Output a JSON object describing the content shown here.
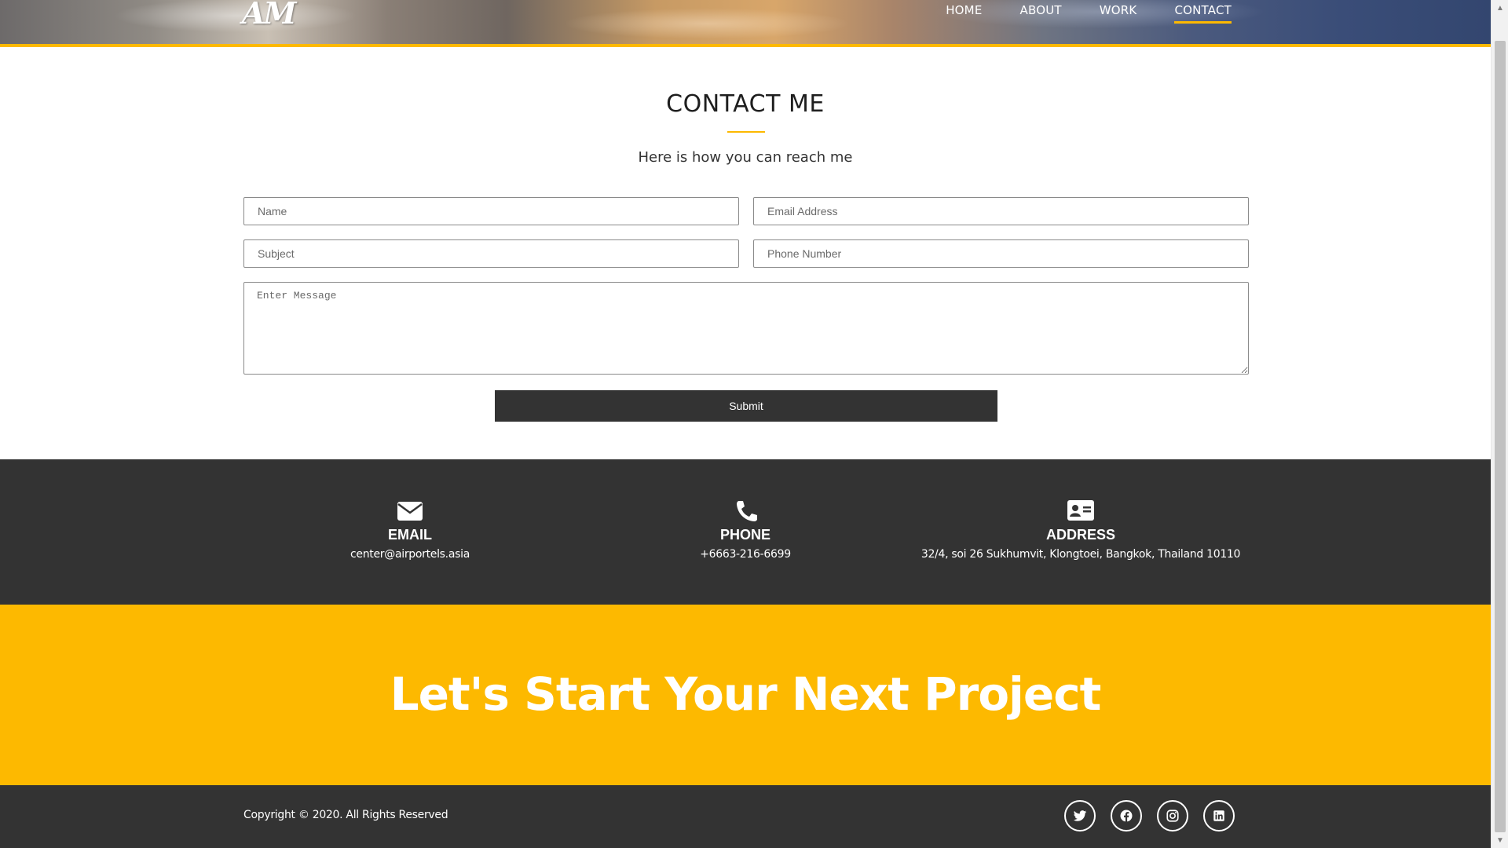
{
  "header": {
    "logo_text": "AM",
    "nav": [
      {
        "label": "HOME"
      },
      {
        "label": "ABOUT"
      },
      {
        "label": "WORK"
      },
      {
        "label": "CONTACT",
        "active": true
      }
    ]
  },
  "contact": {
    "title": "CONTACT ME",
    "subtitle": "Here is how you can reach me",
    "form": {
      "name_placeholder": "Name",
      "email_placeholder": "Email Address",
      "subject_placeholder": "Subject",
      "phone_placeholder": "Phone Number",
      "message_placeholder": "Enter Message",
      "submit_label": "Submit"
    }
  },
  "info": {
    "email": {
      "icon": "envelope-icon",
      "label": "EMAIL",
      "value": "center@airportels.asia"
    },
    "phone": {
      "icon": "phone-icon",
      "label": "PHONE",
      "value": "+6663-216-6699"
    },
    "address": {
      "icon": "address-card-icon",
      "label": "ADDRESS",
      "value": "32/4, soi 26 Sukhumvit, Klongtoei, Bangkok, Thailand 10110"
    }
  },
  "cta": {
    "text": "Let's Start Your Next Project"
  },
  "footer": {
    "copyright": "Copyright © 2020. All Rights Reserved",
    "socials": [
      "twitter-icon",
      "facebook-icon",
      "instagram-icon",
      "linkedin-icon"
    ]
  },
  "colors": {
    "accent": "#fdb900",
    "dark": "#333333",
    "white": "#ffffff"
  }
}
